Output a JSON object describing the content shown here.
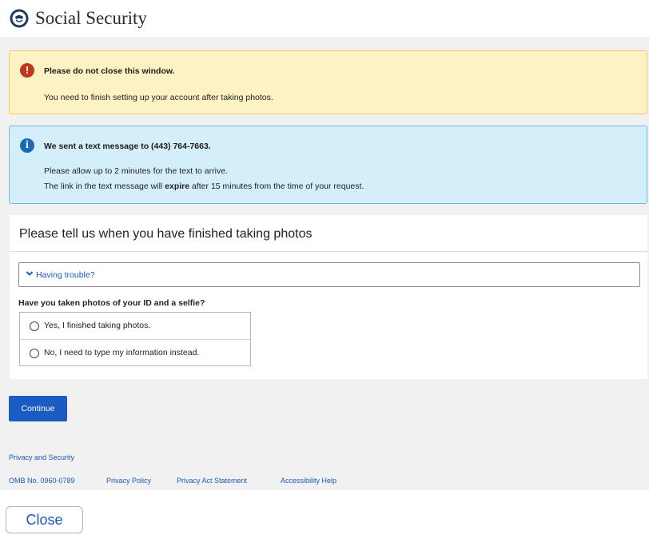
{
  "header": {
    "brand": "Social Security",
    "logo_icon": "ssa-seal-icon"
  },
  "warning": {
    "icon": "exclamation-icon",
    "title": "Please do not close this window.",
    "line1": "You need to finish setting up your account after taking photos."
  },
  "info": {
    "icon": "info-icon",
    "title": "We sent a text message to (443) 764-7663.",
    "line1": "Please allow up to 2 minutes for the text to arrive.",
    "line2_pre": "The link in the text message will ",
    "line2_bold": "expire",
    "line2_post": " after 15 minutes from the time of your request."
  },
  "card": {
    "title": "Please tell us when you have finished taking photos",
    "trouble_label": "Having trouble?",
    "question": "Have you taken photos of your ID and a selfie?",
    "options": [
      {
        "label": "Yes, I finished taking photos."
      },
      {
        "label": "No, I need to type my information instead."
      }
    ]
  },
  "actions": {
    "continue_label": "Continue",
    "close_label": "Close"
  },
  "footer": {
    "privacy_security": "Privacy and Security",
    "omb": "OMB No. 0960-0789",
    "links": [
      "Privacy Policy",
      "Privacy Act Statement",
      "Accessibility Help"
    ]
  },
  "colors": {
    "primary": "#1a5bc4",
    "link": "#1a5bb7",
    "warning_bg": "#fdf2c4",
    "info_bg": "#d4eff9"
  }
}
